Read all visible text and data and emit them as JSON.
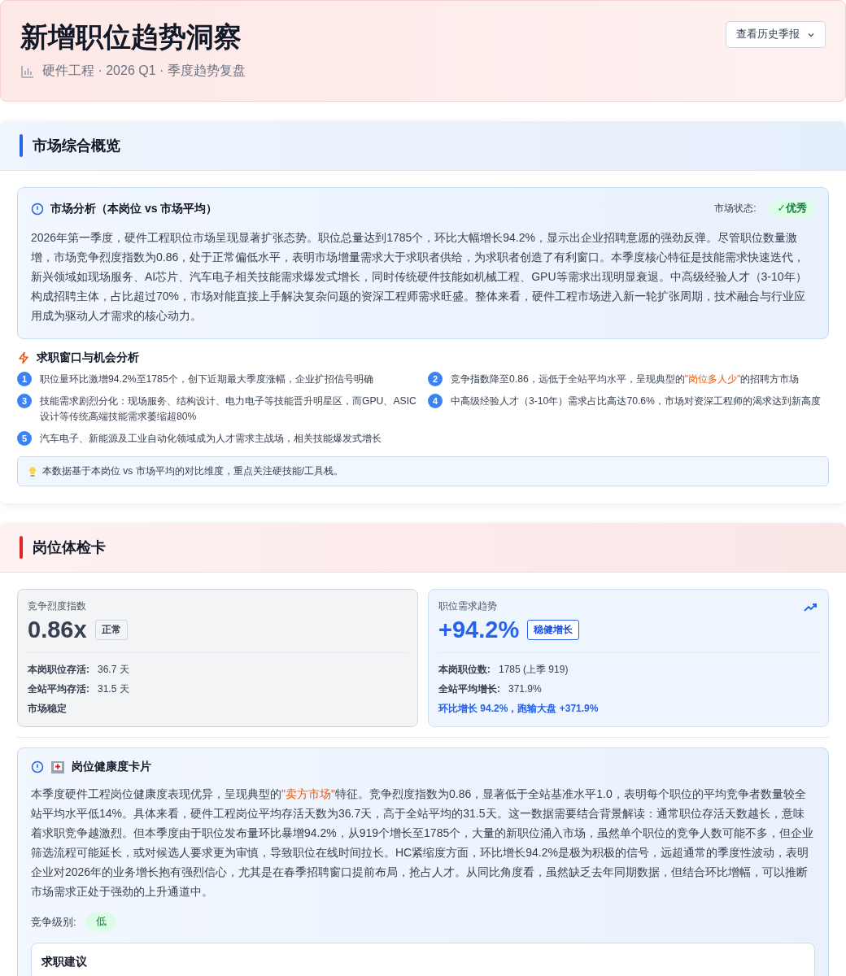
{
  "header": {
    "title": "新增职位趋势洞察",
    "subtitle": "硬件工程 · 2026 Q1 · 季度趋势复盘",
    "history_button": "查看历史季报"
  },
  "overview": {
    "title": "市场综合概览",
    "color": "#2563eb",
    "analysis": {
      "title": "市场分析（本岗位 vs 市场平均）",
      "status_label": "市场状态:",
      "status": {
        "text": "✓优秀",
        "kind": "good"
      },
      "text": "2026年第一季度，硬件工程职位市场呈现显著扩张态势。职位总量达到1785个，环比大幅增长94.2%，显示出企业招聘意愿的强劲反弹。尽管职位数量激增，市场竞争烈度指数为0.86，处于正常偏低水平，表明市场增量需求大于求职者供给，为求职者创造了有利窗口。本季度核心特征是技能需求快速迭代，新兴领域如现场服务、AI芯片、汽车电子相关技能需求爆发式增长，同时传统硬件技能如机械工程、GPU等需求出现明显衰退。中高级经验人才（3-10年）构成招聘主体，占比超过70%，市场对能直接上手解决复杂问题的资深工程师需求旺盛。整体来看，硬件工程市场进入新一轮扩张周期，技术融合与行业应用成为驱动人才需求的核心动力。"
    },
    "opportunities": {
      "title": "求职窗口与机会分析",
      "items": [
        {
          "number": "1",
          "parts": [
            {
              "text": "职位量环比激增94.2%至1785个，创下近期最大季度涨幅，企业扩招信号明确",
              "highlight": false
            }
          ]
        },
        {
          "number": "2",
          "parts": [
            {
              "text": "竞争指数降至0.86，远低于全站平均水平，呈现典型的",
              "highlight": false
            },
            {
              "text": "\"岗位多人少\"",
              "highlight": true
            },
            {
              "text": "的招聘方市场",
              "highlight": false
            }
          ]
        },
        {
          "number": "3",
          "parts": [
            {
              "text": "技能需求剧烈分化：现场服务、结构设计、电力电子等技能晋升明星区，而GPU、ASIC设计等传统高端技能需求萎缩超80%",
              "highlight": false
            }
          ]
        },
        {
          "number": "4",
          "parts": [
            {
              "text": "中高级经验人才（3-10年）需求占比高达70.6%，市场对资深工程师的渴求达到新高度",
              "highlight": false
            }
          ]
        },
        {
          "number": "5",
          "parts": [
            {
              "text": "汽车电子、新能源及工业自动化领域成为人才需求主战场，相关技能爆发式增长",
              "highlight": false
            }
          ]
        }
      ]
    },
    "note": "本数据基于本岗位 vs 市场平均的对比维度，重点关注硬技能/工具栈。"
  },
  "checkup": {
    "title": "岗位体检卡",
    "color": "#dc2626",
    "cards": [
      {
        "kind": "neutral",
        "label": "竞争烈度指数",
        "value": "0.86x",
        "badge": "正常",
        "rows": [
          {
            "label": "本岗职位存活:",
            "value": "36.7 天"
          },
          {
            "label": "全站平均存活:",
            "value": "31.5 天"
          }
        ],
        "footer": "市场稳定"
      },
      {
        "kind": "trend",
        "label": "职位需求趋势",
        "value": "+94.2%",
        "badge": "稳健增长",
        "rows": [
          {
            "label": "本岗职位数:",
            "value": "1785 (上季 919)"
          },
          {
            "label": "全站平均增长:",
            "value": "371.9%"
          }
        ],
        "footer": "环比增长 94.2%，跑输大盘 +371.9%"
      }
    ],
    "health": {
      "title": "岗位健康度卡片",
      "parts": [
        {
          "text": "本季度硬件工程岗位健康度表现优异，呈现典型的",
          "highlight": false
        },
        {
          "text": "\"卖方市场\"",
          "highlight": true
        },
        {
          "text": "特征。竞争烈度指数为0.86，显著低于全站基准水平1.0，表明每个职位的平均竞争者数量较全站平均水平低14%。具体来看，硬件工程岗位平均存活天数为36.7天，高于全站平均的31.5天。这一数据需要结合背景解读：通常职位存活天数越长，意味着求职竞争越激烈。但本季度由于职位发布量环比暴增94.2%，从919个增长至1785个，大量的新职位涌入市场，虽然单个职位的竞争人数可能不多，但企业筛选流程可能延长，或对候选人要求更为审慎，导致职位在线时间拉长。HC紧缩度方面，环比增长94.2%是极为积极的信号，远超通常的季度性波动，表明企业对2026年的业务增长抱有强烈信心，尤其是在春季招聘窗口提前布局，抢占人才。从同比角度看，虽然缺乏去年同期数据，但结合环比增幅，可以推断市场需求正处于强劲的上升通道中。",
          "highlight": false
        }
      ],
      "level_label": "竞争级别:",
      "level": {
        "text": "低",
        "kind": "good"
      },
      "advice_title": "求职建议"
    }
  }
}
